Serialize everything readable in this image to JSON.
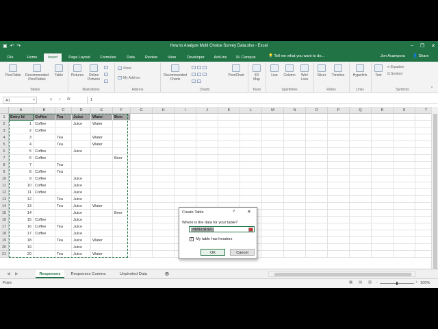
{
  "window": {
    "title": "How to Analyze Multi Choice Survey Data.xlsx - Excel",
    "user": "Jon Acampora",
    "share_label": "Share",
    "tell_me": "Tell me what you want to do..."
  },
  "tabs": [
    "File",
    "Home",
    "Insert",
    "Page Layout",
    "Formulas",
    "Data",
    "Review",
    "Developer",
    "Add-ins",
    "XL Campus"
  ],
  "active_tab": "Insert",
  "ribbon": {
    "pivottable": "PivotTable",
    "recommended_pivottables": [
      "Recommended",
      "PivotTables"
    ],
    "table": "Table",
    "pictures": "Pictures",
    "online_pictures": [
      "Online",
      "Pictures"
    ],
    "store": "Store",
    "my_addins": "My Add-ins",
    "recommended_charts": [
      "Recommended",
      "Charts"
    ],
    "pivotchart": "PivotChart",
    "map3d": [
      "3D",
      "Map"
    ],
    "line": "Line",
    "column": "Column",
    "winloss": [
      "Win/",
      "Loss"
    ],
    "slicer": "Slicer",
    "timeline": "Timeline",
    "hyperlink": "Hyperlink",
    "text": "Text",
    "equation": "Equation",
    "symbol": "Symbol",
    "groups": {
      "tables": "Tables",
      "illustrations": "Illustrations",
      "addins": "Add-ins",
      "charts": "Charts",
      "tours": "Tours",
      "sparklines": "Sparklines",
      "filters": "Filters",
      "links": "Links",
      "symbols": "Symbols"
    }
  },
  "formula_bar": {
    "name_box": "A1",
    "value": "1",
    "fx": "fx"
  },
  "columns": [
    "A",
    "B",
    "C",
    "D",
    "E",
    "F",
    "G",
    "H",
    "I",
    "J",
    "K",
    "L",
    "M",
    "N",
    "O",
    "P",
    "Q",
    "R",
    "S",
    "T"
  ],
  "sheet": {
    "headers": [
      "Entry Id",
      "Coffee",
      "Tea",
      "Juice",
      "Water",
      "Beer"
    ],
    "rows": [
      [
        "1",
        "Coffee",
        "",
        "Juice",
        "Water",
        ""
      ],
      [
        "2",
        "Coffee",
        "",
        "",
        "",
        ""
      ],
      [
        "3",
        "",
        "Tea",
        "",
        "Water",
        ""
      ],
      [
        "4",
        "",
        "Tea",
        "",
        "Water",
        ""
      ],
      [
        "5",
        "Coffee",
        "",
        "Juice",
        "",
        ""
      ],
      [
        "6",
        "Coffee",
        "",
        "",
        "",
        "Beer"
      ],
      [
        "7",
        "",
        "Tea",
        "",
        "",
        ""
      ],
      [
        "8",
        "Coffee",
        "Tea",
        "",
        "",
        ""
      ],
      [
        "9",
        "Coffee",
        "",
        "Juice",
        "",
        ""
      ],
      [
        "10",
        "Coffee",
        "",
        "Juice",
        "",
        ""
      ],
      [
        "11",
        "Coffee",
        "",
        "Juice",
        "",
        ""
      ],
      [
        "12",
        "",
        "Tea",
        "Juice",
        "",
        ""
      ],
      [
        "13",
        "",
        "Tea",
        "Juice",
        "Water",
        ""
      ],
      [
        "14",
        "",
        "",
        "Juice",
        "",
        "Beer"
      ],
      [
        "15",
        "Coffee",
        "",
        "Juice",
        "",
        ""
      ],
      [
        "16",
        "Coffee",
        "Tea",
        "Juice",
        "",
        ""
      ],
      [
        "17",
        "Coffee",
        "",
        "Juice",
        "",
        ""
      ],
      [
        "18",
        "",
        "Tea",
        "Juice",
        "Water",
        ""
      ],
      [
        "19",
        "",
        "",
        "Juice",
        "",
        ""
      ],
      [
        "20",
        "",
        "Tea",
        "Juice",
        "Water",
        ""
      ]
    ]
  },
  "dialog": {
    "title": "Create Table",
    "help": "?",
    "close": "✕",
    "prompt": "Where is the data for your table?",
    "range": "=$A$1:$F$21",
    "has_headers_label": "My table has headers",
    "has_headers_checked": "✓",
    "ok": "OK",
    "cancel": "Cancel"
  },
  "sheets": [
    "Responses",
    "Responses Comma",
    "Unpivoted Data"
  ],
  "active_sheet": "Responses",
  "status": {
    "mode": "Point",
    "zoom": "100%"
  },
  "colors": {
    "excel_green": "#217346",
    "header_fill": "#a6a6a6"
  }
}
